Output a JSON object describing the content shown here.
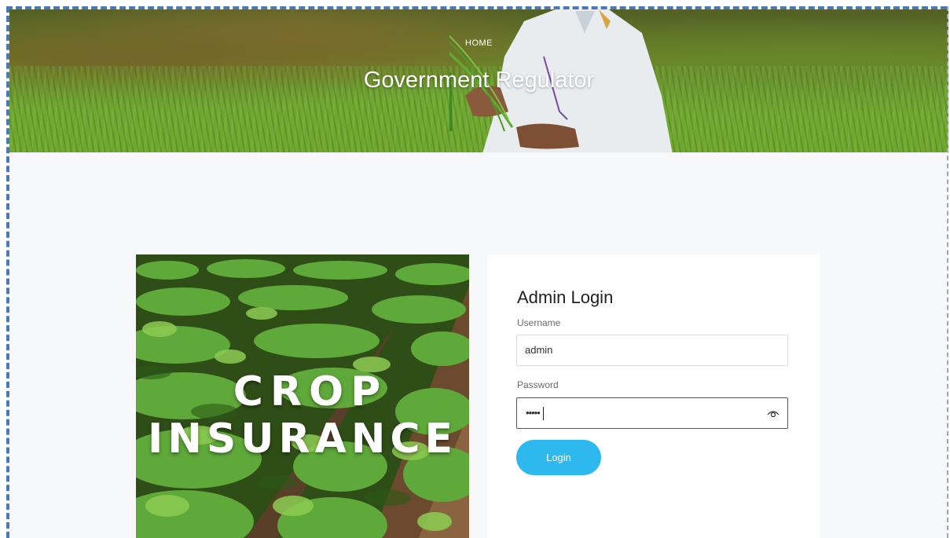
{
  "hero": {
    "breadcrumb": "HOME",
    "title": "Government Regulator"
  },
  "crop_image": {
    "line1": "CROP",
    "line2": "INSURANCE"
  },
  "login": {
    "title": "Admin Login",
    "username_label": "Username",
    "username_value": "admin",
    "password_label": "Password",
    "password_masked": "•••••",
    "button_label": "Login",
    "show_password_icon": "eye-icon"
  },
  "colors": {
    "accent": "#2db8ee",
    "page_background": "#f6f8fa",
    "selection_frame": "#4a78b8"
  }
}
